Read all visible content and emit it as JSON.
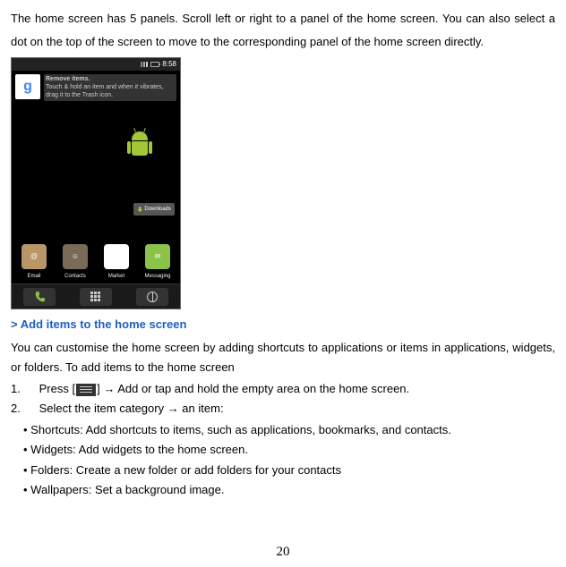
{
  "intro": "The home screen has 5 panels. Scroll left or right to a panel of the home screen. You can also select a dot on the top of the screen to move to the corresponding panel of the home screen directly.",
  "screenshot": {
    "time": "8:58",
    "hint_title": "Remove items.",
    "hint_body": "Touch & hold an item and when it vibrates, drag it to the Trash icon.",
    "downloads_label": "Downloads",
    "dock": {
      "email": "Email",
      "contacts": "Contacts",
      "market": "Market",
      "messaging": "Messaging"
    }
  },
  "heading": "Add items to the home screen",
  "body": "You can customise the home screen by adding shortcuts to applications or items in applications, widgets, or folders. To add items to the home screen",
  "steps": {
    "s1_num": "1.",
    "s1_prefix": "Press [",
    "s1_suffix": "] → Add or tap and hold the empty area on the home screen.",
    "s2_num": "2.",
    "s2_text": "Select the item category   → an item:"
  },
  "bullets": {
    "b1": "Shortcuts: Add shortcuts to items, such as applications, bookmarks, and contacts.",
    "b2": "Widgets: Add widgets to the home screen.",
    "b3": "Folders: Create a new folder or add folders for your contacts",
    "b4": "Wallpapers: Set a background image."
  },
  "page_number": "20"
}
